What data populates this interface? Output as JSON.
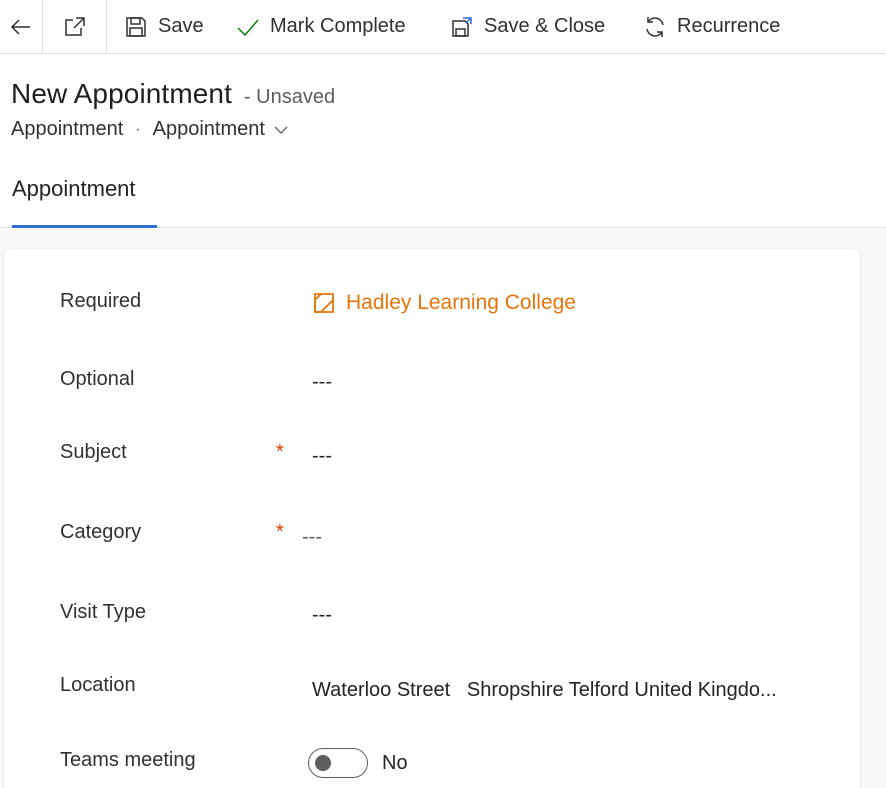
{
  "toolbar": {
    "back_icon": "arrow-left-icon",
    "popout_icon": "open-in-new-window-icon",
    "save_label": "Save",
    "mark_complete_label": "Mark Complete",
    "save_close_label": "Save & Close",
    "recurrence_label": "Recurrence"
  },
  "header": {
    "title": "New Appointment",
    "status": "- Unsaved",
    "entity": "Appointment",
    "separator": "·",
    "form_name": "Appointment"
  },
  "tabs": [
    {
      "label": "Appointment",
      "selected": true
    }
  ],
  "form": {
    "fields": {
      "required": {
        "label": "Required",
        "value": "Hadley Learning College"
      },
      "optional": {
        "label": "Optional",
        "value": "---"
      },
      "subject": {
        "label": "Subject",
        "required_mark": "*",
        "value": "---"
      },
      "category": {
        "label": "Category",
        "required_mark": "*",
        "value": "---"
      },
      "visit_type": {
        "label": "Visit Type",
        "value": "---"
      },
      "location": {
        "label": "Location",
        "value": "Waterloo Street   Shropshire Telford United Kingdo..."
      },
      "teams_meeting": {
        "label": "Teams meeting",
        "value": "No",
        "on": false
      }
    }
  },
  "colors": {
    "accent": "#2f6fd8",
    "lookup_link": "#e8750a",
    "required_star": "#d83b01"
  }
}
